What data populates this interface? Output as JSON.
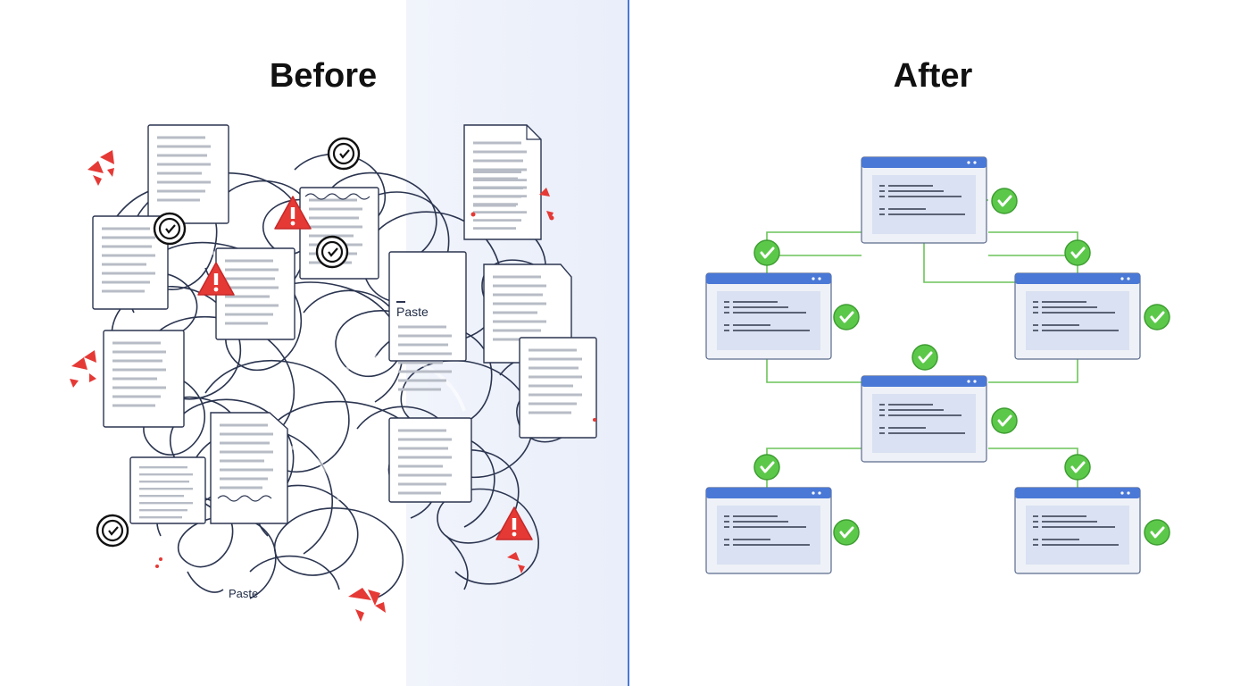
{
  "before": {
    "title": "Before",
    "paste_labels": [
      "Paste",
      "Paste"
    ]
  },
  "after": {
    "title": "After"
  },
  "colors": {
    "accent_blue": "#4a78d6",
    "check_green": "#5cc84a",
    "warning_red": "#e53935",
    "scribble": "#1e2a44"
  },
  "icons": [
    "warning-icon",
    "copyright-icon",
    "check-icon",
    "document-icon",
    "window-icon"
  ]
}
